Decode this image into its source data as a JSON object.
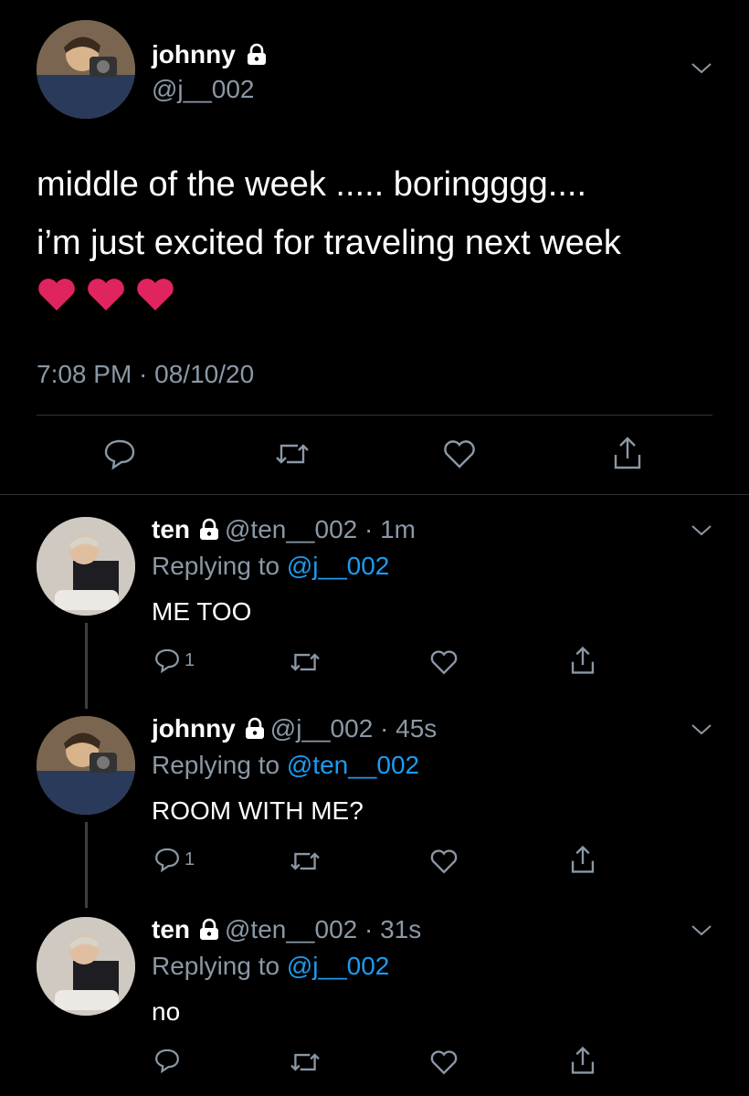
{
  "main_tweet": {
    "name": "johnny",
    "handle": "@j__002",
    "lines": [
      "middle of the week ..... boringggg....",
      "i’m just excited for traveling next week"
    ],
    "emoji": "❤️❤️❤️",
    "timestamp": "7:08 PM · 08/10/20",
    "actions": [
      "reply-icon",
      "retweet-icon",
      "like-icon",
      "share-icon"
    ]
  },
  "replies": [
    {
      "name": "ten",
      "meta": "@ten__002 · 1m",
      "replying_prefix": "Replying to ",
      "replying_to": "@j__002",
      "text": "ME TOO",
      "reply_count": "1"
    },
    {
      "name": "johnny",
      "meta": "@j__002 · 45s",
      "replying_prefix": "Replying to ",
      "replying_to": "@ten__002",
      "text": "ROOM WITH ME?",
      "reply_count": "1"
    },
    {
      "name": "ten",
      "meta": "@ten__002 · 31s",
      "replying_prefix": "Replying to ",
      "replying_to": "@j__002",
      "text": "no",
      "reply_count": ""
    }
  ],
  "colors": {
    "background": "#000000",
    "secondary_text": "#8b98a5",
    "link": "#1d9bf0",
    "heart": "#e0245e"
  }
}
